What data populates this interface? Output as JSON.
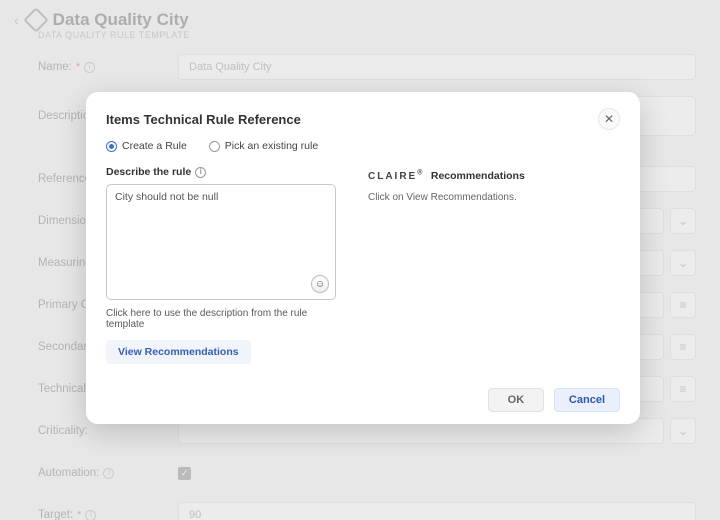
{
  "page": {
    "title": "Data Quality City",
    "subtitle": "DATA QUALITY RULE TEMPLATE",
    "fields": {
      "name": {
        "label": "Name:",
        "value": "Data Quality City",
        "required": true
      },
      "description": {
        "label": "Description:"
      },
      "reference": {
        "label": "Reference:"
      },
      "dimension": {
        "label": "Dimension:"
      },
      "measuring": {
        "label": "Measuring:"
      },
      "primary": {
        "label": "Primary O"
      },
      "secondary": {
        "label": "Secondary:"
      },
      "technical": {
        "label": "Technical I"
      },
      "criticality": {
        "label": "Criticality:"
      },
      "automation": {
        "label": "Automation:"
      },
      "target": {
        "label": "Target:",
        "value": "90",
        "required": true
      }
    }
  },
  "modal": {
    "title": "Items Technical Rule Reference",
    "radios": {
      "create": "Create a Rule",
      "pick": "Pick an existing rule"
    },
    "left": {
      "label": "Describe the rule",
      "value": "City should not be null",
      "hint": "Click here to use the description from the rule template",
      "view_btn": "View Recommendations"
    },
    "right": {
      "brand": "CLAIRE",
      "heading": "Recommendations",
      "hint": "Click on View Recommendations."
    },
    "footer": {
      "ok": "OK",
      "cancel": "Cancel"
    }
  }
}
